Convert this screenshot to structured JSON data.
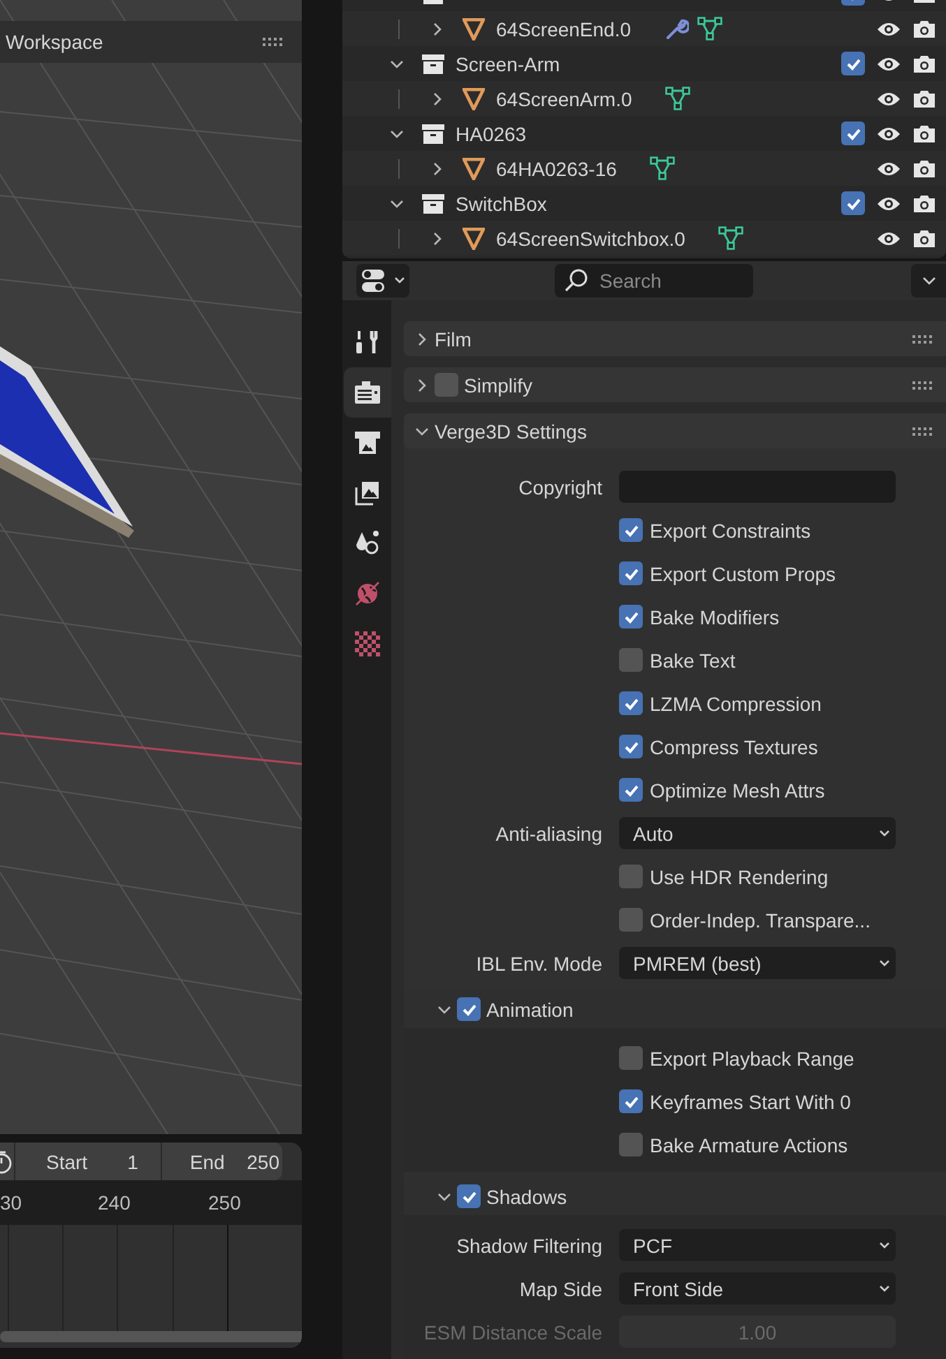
{
  "viewport": {
    "header": "Workspace"
  },
  "timeline": {
    "start_label": "Start",
    "start_value": "1",
    "end_label": "End",
    "end_value": "250",
    "ruler": [
      "30",
      "240",
      "250"
    ]
  },
  "outliner": {
    "collections": [
      {
        "expanded": true,
        "checked": true,
        "children": [
          {
            "name": "64ScreenEnd.0",
            "expanded": false,
            "has_modifier": true
          }
        ]
      },
      {
        "name": "Screen-Arm",
        "expanded": true,
        "checked": true,
        "children": [
          {
            "name": "64ScreenArm.0",
            "expanded": false,
            "has_modifier": false
          }
        ]
      },
      {
        "name": "HA0263",
        "expanded": true,
        "checked": true,
        "children": [
          {
            "name": "64HA0263-16",
            "expanded": false,
            "has_modifier": false
          }
        ]
      },
      {
        "name": "SwitchBox",
        "expanded": true,
        "checked": true,
        "children": [
          {
            "name": "64ScreenSwitchbox.0",
            "expanded": false,
            "has_modifier": false
          }
        ]
      }
    ]
  },
  "properties": {
    "search": {
      "placeholder": "Search"
    },
    "tabs": [
      {
        "kind": "tool",
        "selected": false
      },
      {
        "kind": "render",
        "selected": true
      },
      {
        "kind": "output",
        "selected": false
      },
      {
        "kind": "view_layer",
        "selected": false
      },
      {
        "kind": "scene",
        "selected": false
      },
      {
        "kind": "world",
        "selected": false
      },
      {
        "kind": "texture",
        "selected": false
      }
    ],
    "panels": [
      {
        "title": "Film",
        "expanded": false
      },
      {
        "title": "Simplify",
        "expanded": false,
        "checked": false
      },
      {
        "title": "Verge3D Settings",
        "expanded": true,
        "rows": [
          {
            "kind": "text",
            "label": "Copyright"
          },
          {
            "kind": "checkbox",
            "label": "Export Constraints",
            "checked": true
          },
          {
            "kind": "checkbox",
            "label": "Export Custom Props",
            "checked": true
          },
          {
            "kind": "checkbox",
            "label": "Bake Modifiers",
            "checked": true
          },
          {
            "kind": "checkbox",
            "label": "Bake Text",
            "checked": false
          },
          {
            "kind": "checkbox",
            "label": "LZMA Compression",
            "checked": true
          },
          {
            "kind": "checkbox",
            "label": "Compress Textures",
            "checked": true
          },
          {
            "kind": "checkbox",
            "label": "Optimize Mesh Attrs",
            "checked": true
          },
          {
            "kind": "dropdown",
            "label": "Anti-aliasing",
            "value": "Auto"
          },
          {
            "kind": "checkbox",
            "label": "Use HDR Rendering",
            "checked": false
          },
          {
            "kind": "checkbox",
            "label": "Order-Indep. Transpare...",
            "checked": false
          },
          {
            "kind": "dropdown",
            "label": "IBL Env. Mode",
            "value": "PMREM (best)"
          },
          {
            "kind": "subpanel",
            "title": "Animation",
            "expanded": true,
            "checked": true,
            "rows": [
              {
                "kind": "checkbox",
                "label": "Export Playback Range",
                "checked": false
              },
              {
                "kind": "checkbox",
                "label": "Keyframes Start With 0",
                "checked": true
              },
              {
                "kind": "checkbox",
                "label": "Bake Armature Actions",
                "checked": false
              }
            ]
          },
          {
            "kind": "subpanel",
            "title": "Shadows",
            "expanded": true,
            "checked": true,
            "rows": [
              {
                "kind": "dropdown",
                "label": "Shadow Filtering",
                "value": "PCF"
              },
              {
                "kind": "dropdown",
                "label": "Map Side",
                "value": "Front Side"
              },
              {
                "kind": "number",
                "label": "ESM Distance Scale",
                "value": "1.00",
                "disabled": true
              }
            ]
          }
        ]
      }
    ]
  }
}
